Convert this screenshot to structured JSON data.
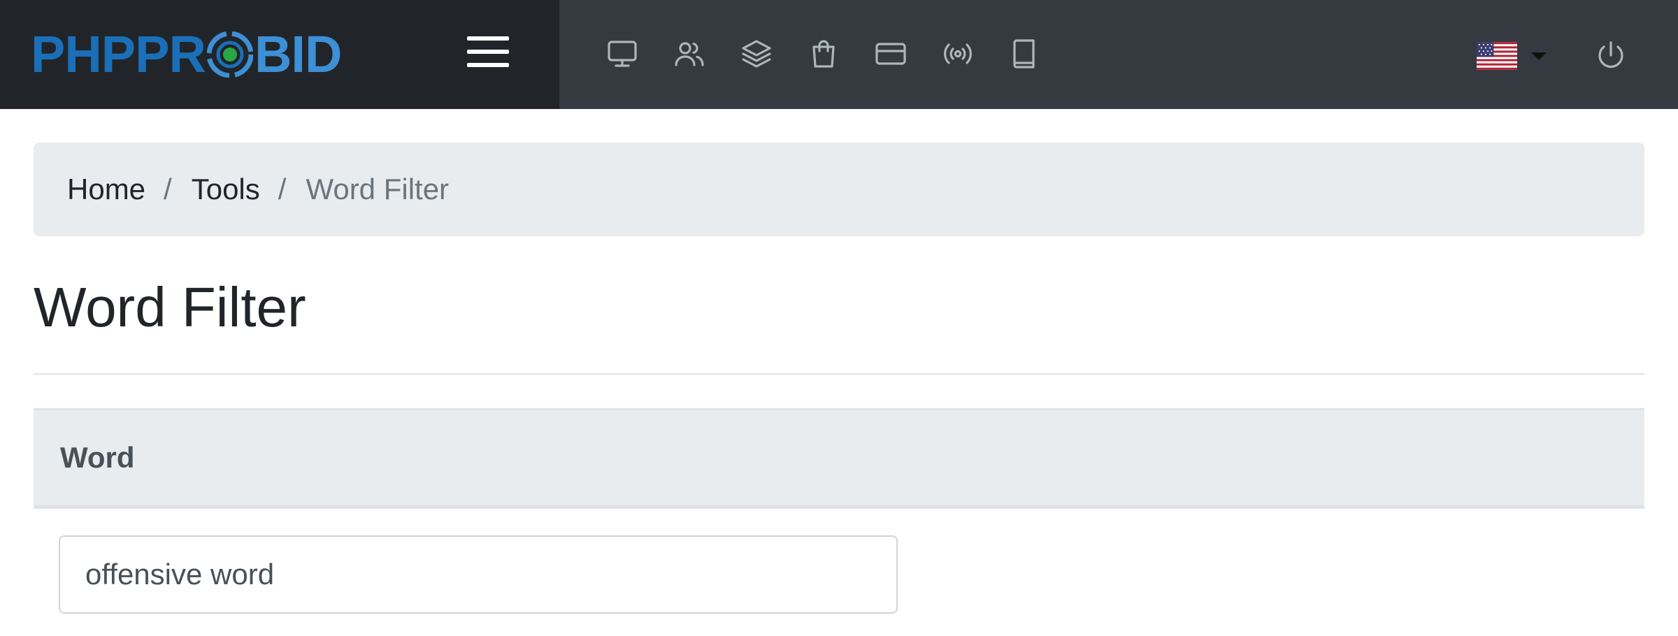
{
  "brand": {
    "logo_text_dark": "PHPPR",
    "logo_text_light": "BID",
    "colors": {
      "primary": "#1a6fb8",
      "secondary": "#3d8fd6",
      "target": "#28a745"
    }
  },
  "navbar": {
    "background": "#343a40",
    "brand_background": "#212529",
    "menu_icon": "hamburger-icon",
    "icons": [
      "monitor-icon",
      "users-icon",
      "layers-icon",
      "shopping-bag-icon",
      "credit-card-icon",
      "broadcast-icon",
      "book-icon"
    ],
    "language_icon": "us-flag-icon",
    "power_icon": "power-icon"
  },
  "breadcrumb": {
    "items": [
      "Home",
      "Tools",
      "Word Filter"
    ],
    "separator": "/"
  },
  "page": {
    "title": "Word Filter"
  },
  "table": {
    "header": "Word",
    "rows": [
      {
        "word": "offensive word"
      }
    ]
  }
}
